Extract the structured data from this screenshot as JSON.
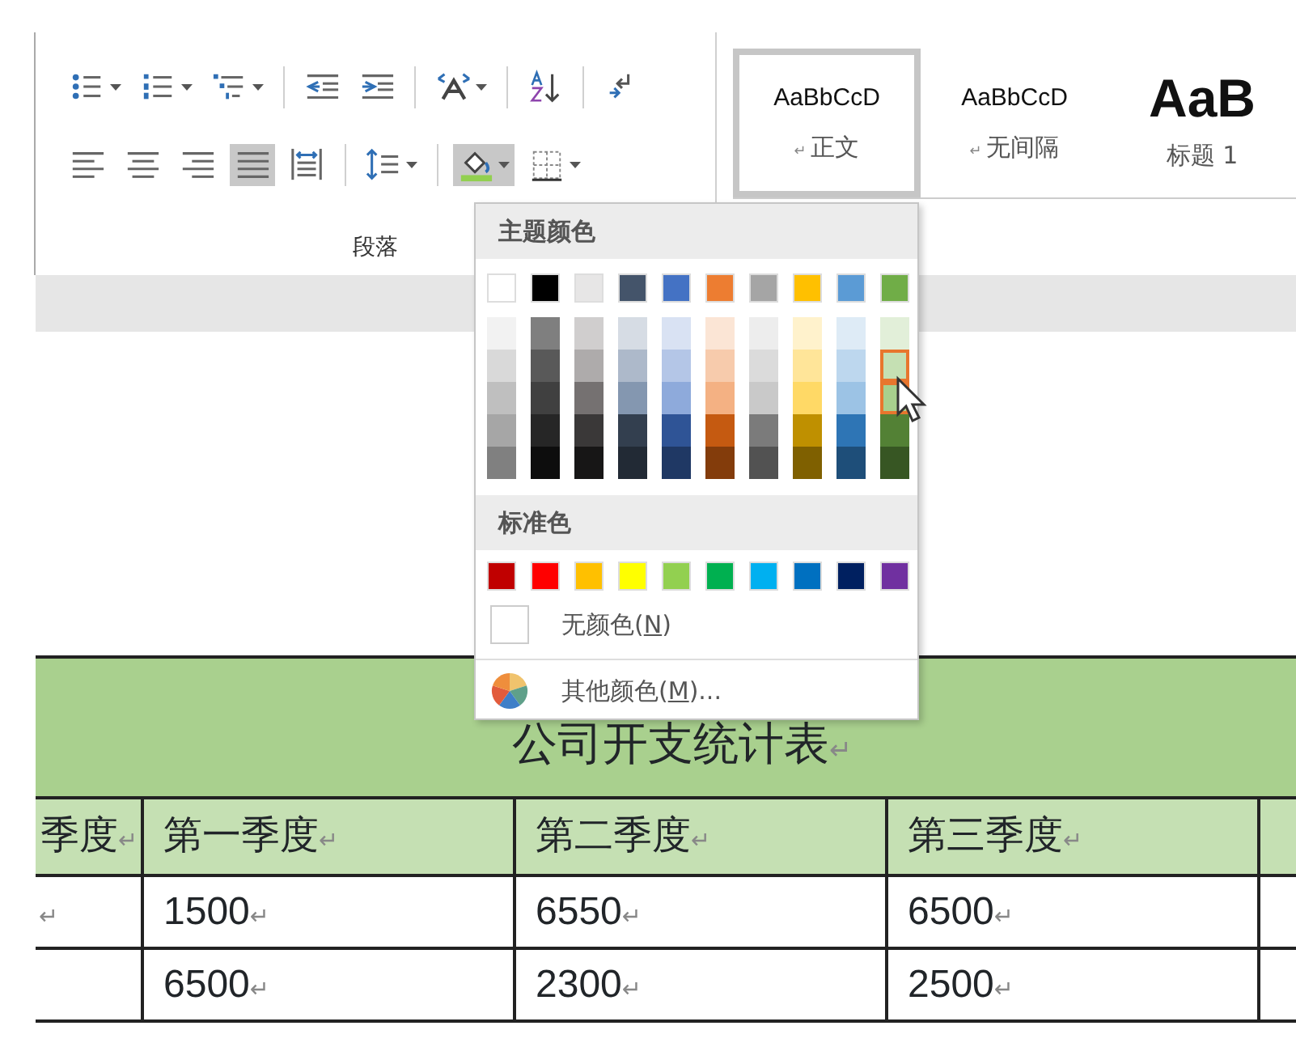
{
  "ribbon": {
    "paragraph_group": {
      "label": "段落",
      "rows": [
        [
          {
            "kind": "bullets",
            "dropdown": true,
            "pressed": false
          },
          {
            "kind": "numbering",
            "dropdown": true,
            "pressed": false
          },
          {
            "kind": "multilevel",
            "dropdown": true,
            "pressed": false
          },
          {
            "kind": "separator"
          },
          {
            "kind": "outdent",
            "dropdown": false,
            "pressed": false
          },
          {
            "kind": "indent",
            "dropdown": false,
            "pressed": false
          },
          {
            "kind": "separator"
          },
          {
            "kind": "asian-layout",
            "dropdown": true,
            "pressed": false
          },
          {
            "kind": "separator"
          },
          {
            "kind": "sort",
            "dropdown": false,
            "pressed": false
          },
          {
            "kind": "separator"
          },
          {
            "kind": "show-marks",
            "dropdown": false,
            "pressed": false
          }
        ],
        [
          {
            "kind": "align-left",
            "dropdown": false,
            "pressed": false
          },
          {
            "kind": "align-center",
            "dropdown": false,
            "pressed": false
          },
          {
            "kind": "align-right",
            "dropdown": false,
            "pressed": false
          },
          {
            "kind": "justify",
            "dropdown": false,
            "pressed": true
          },
          {
            "kind": "distribute",
            "dropdown": false,
            "pressed": false
          },
          {
            "kind": "separator"
          },
          {
            "kind": "line-spacing",
            "dropdown": true,
            "pressed": false
          },
          {
            "kind": "separator"
          },
          {
            "kind": "shading",
            "dropdown": true,
            "pressed": true
          },
          {
            "kind": "borders",
            "dropdown": true,
            "pressed": false
          }
        ]
      ]
    },
    "styles": [
      {
        "kind": "body",
        "preview": "AaBbCcD",
        "mark": "↵",
        "label": "正文",
        "selected": true
      },
      {
        "kind": "body",
        "preview": "AaBbCcD",
        "mark": "↵",
        "label": "无间隔",
        "selected": false
      },
      {
        "kind": "heading",
        "preview": "AaB",
        "label": "标题 1",
        "selected": false
      }
    ]
  },
  "shading_menu": {
    "theme_header": "主题颜色",
    "theme_colors": [
      {
        "color": "#ffffff",
        "selected": false,
        "shades": [
          {
            "color": "#f2f2f2",
            "selected": false
          },
          {
            "color": "#d9d9d9",
            "selected": false
          },
          {
            "color": "#bfbfbf",
            "selected": false
          },
          {
            "color": "#a6a6a6",
            "selected": false
          },
          {
            "color": "#808080",
            "selected": false
          }
        ]
      },
      {
        "color": "#000000",
        "selected": false,
        "shades": [
          {
            "color": "#7f7f7f",
            "selected": false
          },
          {
            "color": "#595959",
            "selected": false
          },
          {
            "color": "#404040",
            "selected": false
          },
          {
            "color": "#262626",
            "selected": false
          },
          {
            "color": "#0d0d0d",
            "selected": false
          }
        ]
      },
      {
        "color": "#e7e6e6",
        "selected": false,
        "shades": [
          {
            "color": "#d0cece",
            "selected": false
          },
          {
            "color": "#aeabab",
            "selected": false
          },
          {
            "color": "#757171",
            "selected": false
          },
          {
            "color": "#3a3838",
            "selected": false
          },
          {
            "color": "#171616",
            "selected": false
          }
        ]
      },
      {
        "color": "#44546a",
        "selected": false,
        "shades": [
          {
            "color": "#d6dce4",
            "selected": false
          },
          {
            "color": "#adb9ca",
            "selected": false
          },
          {
            "color": "#8497b0",
            "selected": false
          },
          {
            "color": "#333f4f",
            "selected": false
          },
          {
            "color": "#222a35",
            "selected": false
          }
        ]
      },
      {
        "color": "#4472c4",
        "selected": false,
        "shades": [
          {
            "color": "#d9e2f3",
            "selected": false
          },
          {
            "color": "#b4c6e7",
            "selected": false
          },
          {
            "color": "#8eaadb",
            "selected": false
          },
          {
            "color": "#2f5496",
            "selected": false
          },
          {
            "color": "#1f3864",
            "selected": false
          }
        ]
      },
      {
        "color": "#ed7d31",
        "selected": false,
        "shades": [
          {
            "color": "#fbe5d5",
            "selected": false
          },
          {
            "color": "#f7cbac",
            "selected": false
          },
          {
            "color": "#f4b183",
            "selected": false
          },
          {
            "color": "#c55a11",
            "selected": false
          },
          {
            "color": "#833c0b",
            "selected": false
          }
        ]
      },
      {
        "color": "#a5a5a5",
        "selected": false,
        "shades": [
          {
            "color": "#ededed",
            "selected": false
          },
          {
            "color": "#dbdbdb",
            "selected": false
          },
          {
            "color": "#c9c9c9",
            "selected": false
          },
          {
            "color": "#7b7b7b",
            "selected": false
          },
          {
            "color": "#525252",
            "selected": false
          }
        ]
      },
      {
        "color": "#ffc000",
        "selected": false,
        "shades": [
          {
            "color": "#fff2cc",
            "selected": false
          },
          {
            "color": "#ffe599",
            "selected": false
          },
          {
            "color": "#ffd966",
            "selected": false
          },
          {
            "color": "#bf9000",
            "selected": false
          },
          {
            "color": "#7f6000",
            "selected": false
          }
        ]
      },
      {
        "color": "#5b9bd5",
        "selected": false,
        "shades": [
          {
            "color": "#deebf6",
            "selected": false
          },
          {
            "color": "#bdd7ee",
            "selected": false
          },
          {
            "color": "#9cc3e5",
            "selected": false
          },
          {
            "color": "#2e75b5",
            "selected": false
          },
          {
            "color": "#1e4e79",
            "selected": false
          }
        ]
      },
      {
        "color": "#70ad47",
        "selected": false,
        "shades": [
          {
            "color": "#e2efd9",
            "selected": false
          },
          {
            "color": "#c5e0b3",
            "selected": true
          },
          {
            "color": "#a8d08d",
            "selected": true
          },
          {
            "color": "#538135",
            "selected": false
          },
          {
            "color": "#375623",
            "selected": false
          }
        ]
      }
    ],
    "standard_header": "标准色",
    "standard_colors": [
      {
        "color": "#c00000",
        "selected": false
      },
      {
        "color": "#ff0000",
        "selected": false
      },
      {
        "color": "#ffc000",
        "selected": false
      },
      {
        "color": "#ffff00",
        "selected": false
      },
      {
        "color": "#92d050",
        "selected": false
      },
      {
        "color": "#00b050",
        "selected": false
      },
      {
        "color": "#00b0f0",
        "selected": false
      },
      {
        "color": "#0070c0",
        "selected": false
      },
      {
        "color": "#002060",
        "selected": false
      },
      {
        "color": "#7030a0",
        "selected": false
      }
    ],
    "no_color": {
      "before": "无颜色(",
      "accelerator": "N",
      "after": ")"
    },
    "more_colors": {
      "before": "其他颜色(",
      "accelerator": "M",
      "after": ")..."
    }
  },
  "table": {
    "title": {
      "text": "公司开支统计表",
      "mark": "↵"
    },
    "header": [
      {
        "text": "季度",
        "mark": "↵"
      },
      {
        "text": "第一季度",
        "mark": "↵"
      },
      {
        "text": "第二季度",
        "mark": "↵"
      },
      {
        "text": "第三季度",
        "mark": "↵"
      }
    ],
    "rows": [
      {
        "label_mark": "↵",
        "cells": [
          {
            "text": "1500",
            "mark": "↵"
          },
          {
            "text": "6550",
            "mark": "↵"
          },
          {
            "text": "6500",
            "mark": "↵"
          }
        ]
      },
      {
        "cells": [
          {
            "text": "6500",
            "mark": "↵"
          },
          {
            "text": "2300",
            "mark": "↵"
          },
          {
            "text": "2500",
            "mark": "↵"
          }
        ]
      }
    ]
  }
}
